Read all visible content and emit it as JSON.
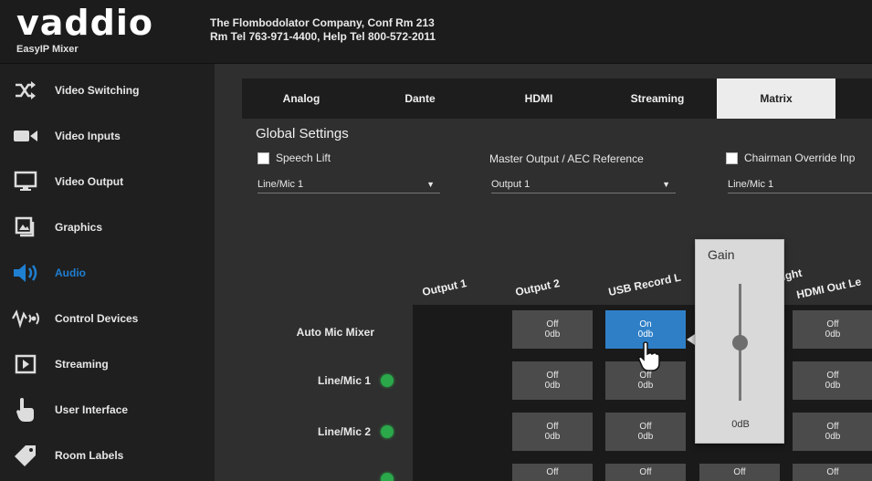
{
  "brand": {
    "logo_text": "vaddio",
    "product": "EasyIP Mixer"
  },
  "header": {
    "line1": "The Flombodolator Company, Conf Rm 213",
    "line2": "Rm Tel 763-971-4400, Help Tel 800-572-2011"
  },
  "sidebar": {
    "items": [
      {
        "label": "Video Switching",
        "icon": "shuffle-icon"
      },
      {
        "label": "Video Inputs",
        "icon": "video-camera-icon"
      },
      {
        "label": "Video Output",
        "icon": "monitor-icon"
      },
      {
        "label": "Graphics",
        "icon": "graphics-icon"
      },
      {
        "label": "Audio",
        "icon": "speaker-icon",
        "active": true
      },
      {
        "label": "Control Devices",
        "icon": "control-devices-icon"
      },
      {
        "label": "Streaming",
        "icon": "play-icon"
      },
      {
        "label": "User Interface",
        "icon": "touch-hand-icon"
      },
      {
        "label": "Room Labels",
        "icon": "tag-icon"
      }
    ]
  },
  "tabs": [
    "Analog",
    "Dante",
    "HDMI",
    "Streaming",
    "Matrix"
  ],
  "active_tab": "Matrix",
  "global_settings": {
    "title": "Global Settings",
    "speech_lift": {
      "label": "Speech Lift",
      "checked": false
    },
    "speech_lift_select": "Line/Mic 1",
    "master_output": {
      "label": "Master Output / AEC Reference",
      "value": "Output 1"
    },
    "chairman": {
      "label": "Chairman Override Inp",
      "checked": false
    },
    "chairman_select": "Line/Mic 1"
  },
  "matrix": {
    "columns": [
      "Output 1",
      "Output 2",
      "USB Record L",
      "USB Record Right",
      "HDMI Out Le"
    ],
    "partial_column_tail": "ight",
    "rows": [
      {
        "label": "Auto Mic Mixer",
        "led": false
      },
      {
        "label": "Line/Mic 1",
        "led": true
      },
      {
        "label": "Line/Mic 2",
        "led": true
      },
      {
        "label": "",
        "led": true
      }
    ],
    "cells": [
      [
        null,
        {
          "state": "Off",
          "gain": "0db"
        },
        {
          "state": "On",
          "gain": "0db",
          "on": true
        },
        null,
        {
          "state": "Off",
          "gain": "0db"
        }
      ],
      [
        null,
        {
          "state": "Off",
          "gain": "0db"
        },
        {
          "state": "Off",
          "gain": "0db"
        },
        null,
        {
          "state": "Off",
          "gain": "0db"
        }
      ],
      [
        null,
        {
          "state": "Off",
          "gain": "0db"
        },
        {
          "state": "Off",
          "gain": "0db"
        },
        null,
        {
          "state": "Off",
          "gain": "0db"
        }
      ],
      [
        null,
        {
          "state": "Off",
          "gain": ""
        },
        {
          "state": "Off",
          "gain": ""
        },
        {
          "state": "Off",
          "gain": ""
        },
        {
          "state": "Off",
          "gain": ""
        }
      ]
    ]
  },
  "gain_popup": {
    "title": "Gain",
    "value": "0dB",
    "level": 0.5
  },
  "colors": {
    "accent": "#1f7fd1",
    "led": "#2aa84a",
    "cell_on": "#2f7fc6"
  }
}
